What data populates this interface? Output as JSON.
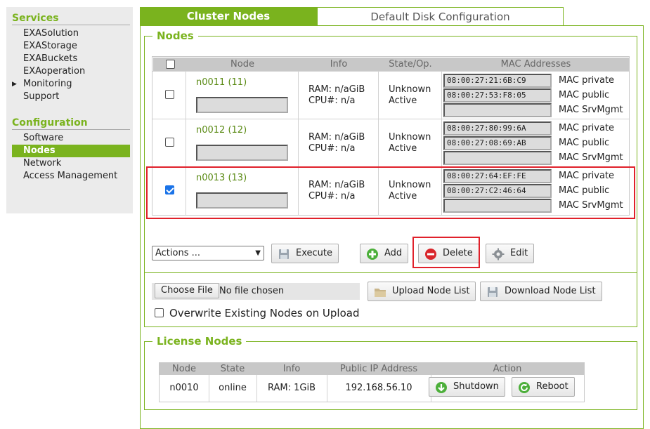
{
  "sidebar": {
    "services_title": "Services",
    "services": [
      "EXASolution",
      "EXAStorage",
      "EXABuckets",
      "EXAoperation",
      "Monitoring",
      "Support"
    ],
    "configuration_title": "Configuration",
    "configuration": [
      "Software",
      "Nodes",
      "Network",
      "Access Management"
    ],
    "active_item": "Nodes"
  },
  "tabs": {
    "active": "Cluster Nodes",
    "inactive": "Default Disk Configuration"
  },
  "nodes": {
    "legend": "Nodes",
    "headers": {
      "node": "Node",
      "info": "Info",
      "state": "State/Op.",
      "mac": "MAC Addresses"
    },
    "rows": [
      {
        "name": "n0011 (11)",
        "ram": "RAM: n/aGiB",
        "cpu": "CPU#: n/a",
        "state": "Unknown",
        "op": "Active",
        "checked": false,
        "mac_private": "08:00:27:21:6B:C9",
        "mac_public": "08:00:27:53:F8:05",
        "mac_srvmgmt": ""
      },
      {
        "name": "n0012 (12)",
        "ram": "RAM: n/aGiB",
        "cpu": "CPU#: n/a",
        "state": "Unknown",
        "op": "Active",
        "checked": false,
        "mac_private": "08:00:27:80:99:6A",
        "mac_public": "08:00:27:08:69:AB",
        "mac_srvmgmt": ""
      },
      {
        "name": "n0013 (13)",
        "ram": "RAM: n/aGiB",
        "cpu": "CPU#: n/a",
        "state": "Unknown",
        "op": "Active",
        "checked": true,
        "mac_private": "08:00:27:64:EF:FE",
        "mac_public": "08:00:27:C2:46:64",
        "mac_srvmgmt": ""
      }
    ],
    "mac_labels": {
      "private": "MAC private",
      "public": "MAC public",
      "srvmgmt": "MAC SrvMgmt"
    }
  },
  "actions": {
    "select_value": "Actions ...",
    "execute": "Execute",
    "add": "Add",
    "delete": "Delete",
    "edit": "Edit"
  },
  "upload": {
    "choose_file": "Choose File",
    "file_status": "No file chosen",
    "upload_button": "Upload Node List",
    "download_button": "Download Node List",
    "overwrite_label": "Overwrite Existing Nodes on Upload"
  },
  "license": {
    "legend": "License Nodes",
    "headers": {
      "node": "Node",
      "state": "State",
      "info": "Info",
      "ip": "Public IP Address",
      "action": "Action"
    },
    "row": {
      "node": "n0010",
      "state": "online",
      "info": "RAM: 1GiB",
      "ip": "192.168.56.10"
    },
    "shutdown": "Shutdown",
    "reboot": "Reboot"
  },
  "colors": {
    "accent": "#7ab31e",
    "highlight": "#e0212b",
    "checkbox_checked": "#1a73e8"
  }
}
